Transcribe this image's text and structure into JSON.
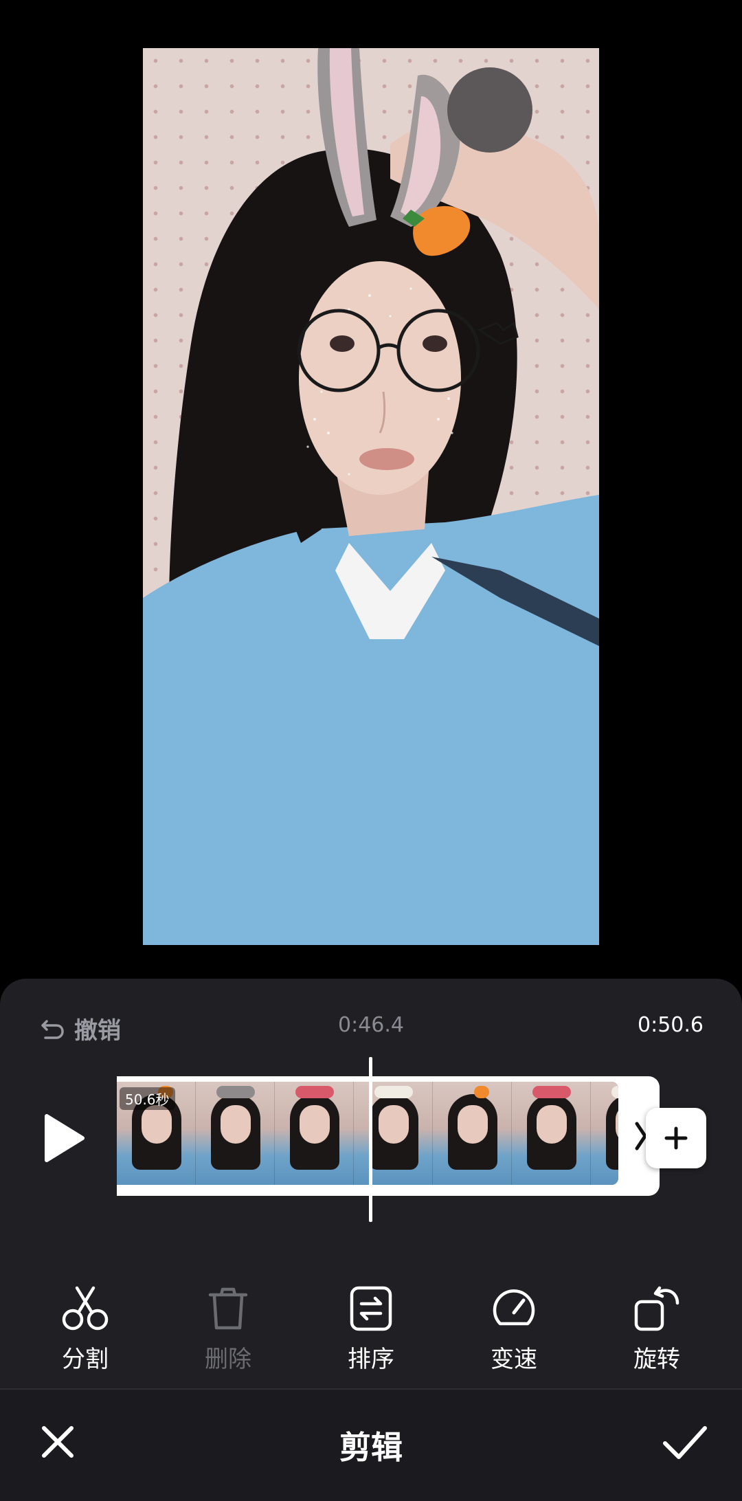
{
  "editor": {
    "undo_label": "撤销",
    "current_time": "0:46.4",
    "total_time": "0:50.6",
    "clip_duration": "50.6秒",
    "title": "剪辑"
  },
  "tools": [
    {
      "label": "分割",
      "icon": "scissors-icon",
      "enabled": true
    },
    {
      "label": "删除",
      "icon": "trash-icon",
      "enabled": false
    },
    {
      "label": "排序",
      "icon": "sort-icon",
      "enabled": true
    },
    {
      "label": "变速",
      "icon": "speed-gauge-icon",
      "enabled": true
    },
    {
      "label": "旋转",
      "icon": "rotate-icon",
      "enabled": true
    }
  ],
  "colors": {
    "panel_background": "#202024",
    "bottom_bar_background": "#1b1b1f",
    "disabled_text": "#6b6b72",
    "muted_text": "#8a8a92"
  }
}
